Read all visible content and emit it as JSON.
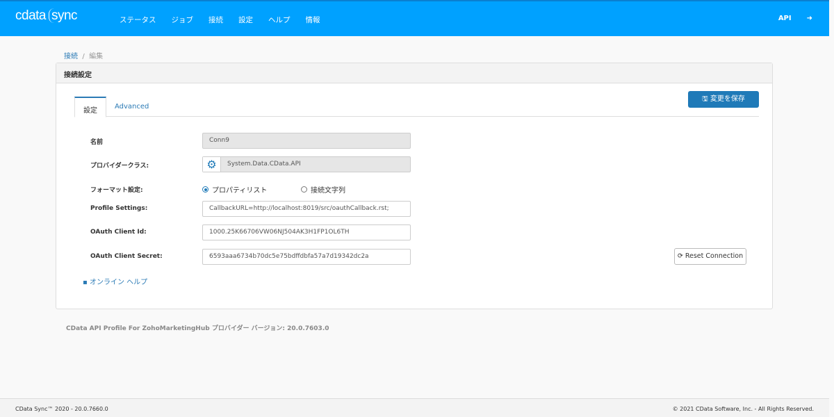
{
  "header": {
    "logo": "cdata",
    "logo_sub": "sync",
    "nav": [
      "ステータス",
      "ジョブ",
      "接続",
      "設定",
      "ヘルプ",
      "情報"
    ],
    "api": "API",
    "logout_icon": "sign-out-icon"
  },
  "breadcrumb": {
    "parent": "接続",
    "separator": "/",
    "current": "編集"
  },
  "panel": {
    "title": "接続設定",
    "tabs": [
      "設定",
      "Advanced"
    ],
    "save": "変更を保存"
  },
  "form": {
    "name_label": "名前",
    "name_value": "Conn9",
    "provider_label": "プロバイダークラス:",
    "provider_value": "System.Data.CData.API",
    "format_label": "フォーマット設定:",
    "format_options": [
      "プロパティリスト",
      "接続文字列"
    ],
    "format_selected": "プロパティリスト",
    "profile_label": "Profile Settings:",
    "profile_value": "CallbackURL=http://localhost:8019/src/oauthCallback.rst;",
    "client_id_label": "OAuth Client Id:",
    "client_id_value": "1000.25K66706VW06NJ504AK3H1FP1OL6TH",
    "client_secret_label": "OAuth Client Secret:",
    "client_secret_value": "6593aaa6734b70dc5e75bdffdbfa57a7d19342dc2a"
  },
  "reset": "Reset Connection",
  "help": "オンライン ヘルプ",
  "version": "CData API Profile For ZohoMarketingHub プロバイダー バージョン: 20.0.7603.0",
  "footer": {
    "left": "CData Sync™ 2020 - 20.0.7660.0",
    "right": "© 2021 CData Software, Inc. - All Rights Reserved."
  }
}
